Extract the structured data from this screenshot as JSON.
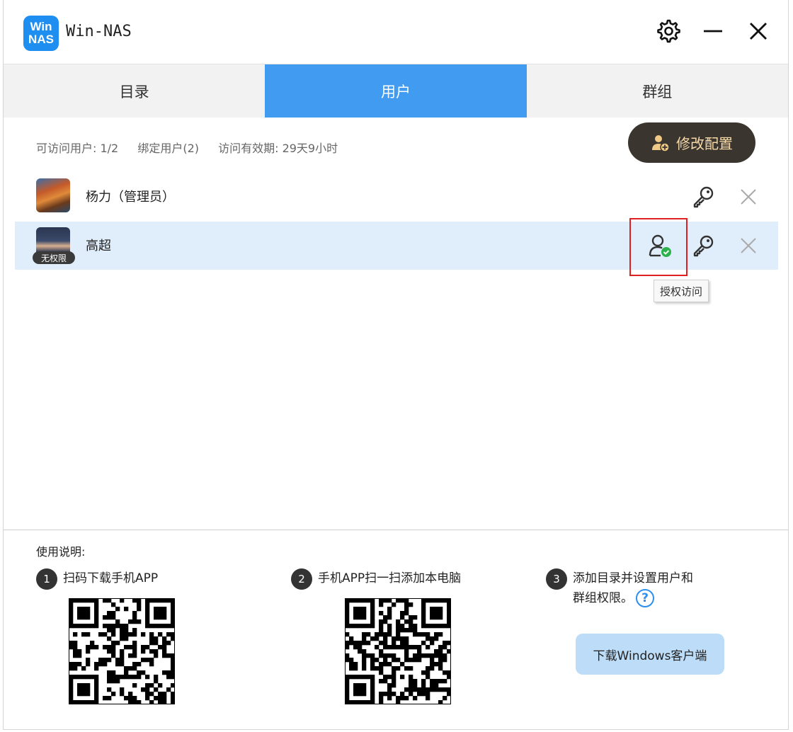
{
  "app": {
    "logo_line1": "Win",
    "logo_line2": "NAS",
    "title": "Win-NAS"
  },
  "tabs": [
    {
      "label": "目录",
      "active": false
    },
    {
      "label": "用户",
      "active": true
    },
    {
      "label": "群组",
      "active": false
    }
  ],
  "info": {
    "accessible_users": "可访问用户: 1/2",
    "bound_users": "绑定用户(2)",
    "validity": "访问有效期: 29天9小时"
  },
  "config_button": {
    "label": "修改配置"
  },
  "users": [
    {
      "name": "杨力（管理员）",
      "badge": "",
      "selected": false
    },
    {
      "name": "高超",
      "badge": "无权限",
      "selected": true
    }
  ],
  "tooltip": "授权访问",
  "instructions": {
    "title": "使用说明:",
    "steps": [
      {
        "num": "1",
        "text": "扫码下载手机APP"
      },
      {
        "num": "2",
        "text": "手机APP扫一扫添加本电脑"
      },
      {
        "num": "3",
        "text_line1": "添加目录并设置用户和",
        "text_line2": "群组权限。"
      }
    ],
    "help_glyph": "?",
    "download_button": "下载Windows客户端"
  },
  "colors": {
    "accent": "#419bf0",
    "config_bg": "#3b3530",
    "config_text": "#f5d9a8",
    "selected_row": "#e0eefc",
    "highlight": "#e02020"
  }
}
